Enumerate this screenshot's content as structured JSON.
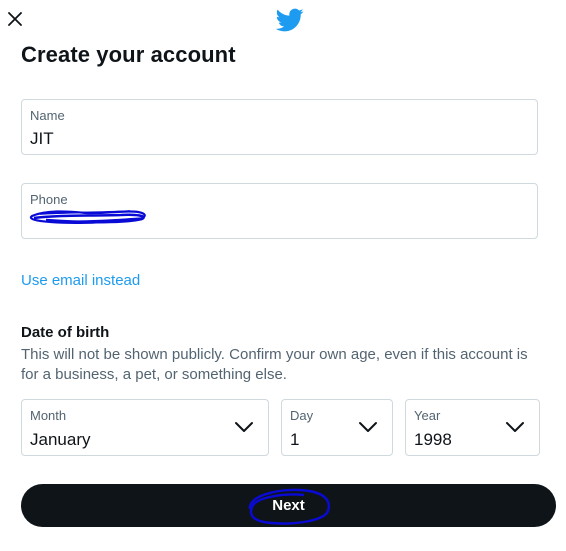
{
  "header": {
    "close_icon": "close-icon",
    "logo_icon": "twitter-bird-icon",
    "brand_color": "#1d9bf0"
  },
  "title": "Create your account",
  "form": {
    "name": {
      "label": "Name",
      "value": "JIT"
    },
    "phone": {
      "label": "Phone",
      "value": ""
    },
    "use_email_link": "Use email instead"
  },
  "dob": {
    "title": "Date of birth",
    "description": "This will not be shown publicly. Confirm your own age, even if this account is for a business, a pet, or something else.",
    "month": {
      "label": "Month",
      "value": "January"
    },
    "day": {
      "label": "Day",
      "value": "1"
    },
    "year": {
      "label": "Year",
      "value": "1998"
    }
  },
  "next_button": {
    "label": "Next"
  },
  "colors": {
    "text": "#0f1419",
    "muted": "#536471",
    "border": "#cfd9de",
    "button_bg": "#0f1419",
    "annotation": "#0a0ad6"
  }
}
